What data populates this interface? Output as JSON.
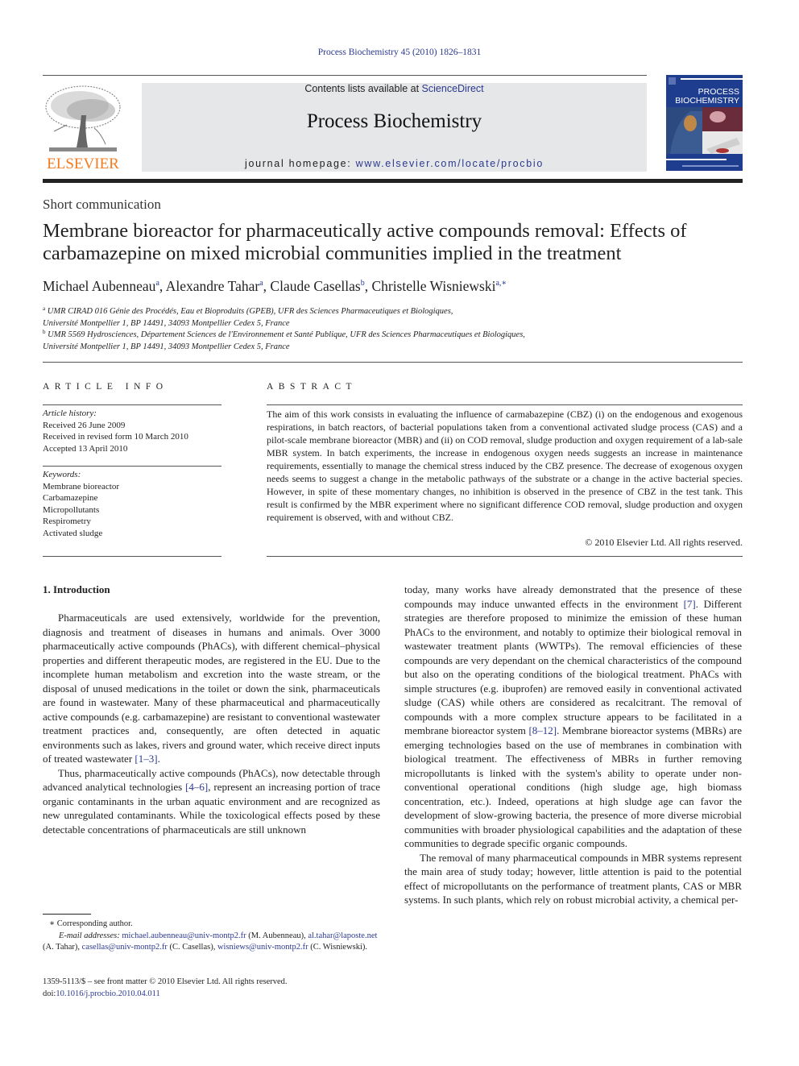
{
  "header": {
    "citation": "Process Biochemistry 45 (2010) 1826–1831",
    "contents_prefix": "Contents lists available at ",
    "contents_link": "ScienceDirect",
    "journal_title": "Process Biochemistry",
    "homepage_prefix": "journal homepage: ",
    "homepage_link": "www.elsevier.com/locate/procbio",
    "publisher_logo_text": "ELSEVIER",
    "cover_title_line1": "PROCESS",
    "cover_title_line2": "BIOCHEMISTRY"
  },
  "article": {
    "section_type": "Short communication",
    "title": "Membrane bioreactor for pharmaceutically active compounds removal: Effects of carbamazepine on mixed microbial communities implied in the treatment",
    "authors": [
      {
        "name": "Michael Aubenneau",
        "sup": "a"
      },
      {
        "name": "Alexandre Tahar",
        "sup": "a"
      },
      {
        "name": "Claude Casellas",
        "sup": "b"
      },
      {
        "name": "Christelle Wisniewski",
        "sup": "a,∗"
      }
    ],
    "affiliations": [
      {
        "sup": "a",
        "line1": "UMR CIRAD 016 Génie des Procédés, Eau et Bioproduits (GPEB), UFR des Sciences Pharmaceutiques et Biologiques,",
        "line2": "Université Montpellier 1, BP 14491, 34093 Montpellier Cedex 5, France"
      },
      {
        "sup": "b",
        "line1": "UMR 5569 Hydrosciences, Département Sciences de l'Environnement et Santé Publique, UFR des Sciences Pharmaceutiques et Biologiques,",
        "line2": "Université Montpellier 1, BP 14491, 34093 Montpellier Cedex 5, France"
      }
    ]
  },
  "article_info": {
    "heading": "ARTICLE INFO",
    "history_label": "Article history:",
    "history": [
      "Received 26 June 2009",
      "Received in revised form 10 March 2010",
      "Accepted 13 April 2010"
    ],
    "keywords_label": "Keywords:",
    "keywords": [
      "Membrane bioreactor",
      "Carbamazepine",
      "Micropollutants",
      "Respirometry",
      "Activated sludge"
    ]
  },
  "abstract": {
    "heading": "ABSTRACT",
    "text": "The aim of this work consists in evaluating the influence of carmabazepine (CBZ) (i) on the endogenous and exogenous respirations, in batch reactors, of bacterial populations taken from a conventional activated sludge process (CAS) and a pilot-scale membrane bioreactor (MBR) and (ii) on COD removal, sludge production and oxygen requirement of a lab-sale MBR system. In batch experiments, the increase in endogenous oxygen needs suggests an increase in maintenance requirements, essentially to manage the chemical stress induced by the CBZ presence. The decrease of exogenous oxygen needs seems to suggest a change in the metabolic pathways of the substrate or a change in the active bacterial species. However, in spite of these momentary changes, no inhibition is observed in the presence of CBZ in the test tank. This result is confirmed by the MBR experiment where no significant difference COD removal, sludge production and oxygen requirement is observed, with and without CBZ.",
    "copyright": "© 2010 Elsevier Ltd. All rights reserved."
  },
  "body": {
    "section_heading": "1.  Introduction",
    "left_p1": "Pharmaceuticals are used extensively, worldwide for the prevention, diagnosis and treatment of diseases in humans and animals. Over 3000 pharmaceutically active compounds (PhACs), with different chemical–physical properties and different therapeutic modes, are registered in the EU. Due to the incomplete human metabolism and excretion into the waste stream, or the disposal of unused medications in the toilet or down the sink, pharmaceuticals are found in wastewater. Many of these pharmaceutical and pharmaceutically active compounds (e.g. carbamazepine) are resistant to conventional wastewater treatment practices and, consequently, are often detected in aquatic environments such as lakes, rivers and ground water, which receive direct inputs of treated wastewater ",
    "left_p1_ref": "[1–3]",
    "left_p2_a": "Thus, pharmaceutically active compounds (PhACs), now detectable through advanced analytical technologies ",
    "left_p2_ref": "[4–6]",
    "left_p2_b": ", represent an increasing portion of trace organic contaminants in the urban aquatic environment and are recognized as new unregulated contaminants. While the toxicological effects posed by these detectable concentrations of pharmaceuticals are still unknown",
    "right_p1_a": "today, many works have already demonstrated that the presence of these compounds may induce unwanted effects in the environment ",
    "right_p1_ref1": "[7]",
    "right_p1_b": ". Different strategies are therefore proposed to minimize the emission of these human PhACs to the environment, and notably to optimize their biological removal in wastewater treatment plants (WWTPs). The removal efficiencies of these compounds are very dependant on the chemical characteristics of the compound but also on the operating conditions of the biological treatment. PhACs with simple structures (e.g. ibuprofen) are removed easily in conventional activated sludge (CAS) while others are considered as recalcitrant. The removal of compounds with a more complex structure appears to be facilitated in a membrane bioreactor system ",
    "right_p1_ref2": "[8–12]",
    "right_p1_c": ". Membrane bioreactor systems (MBRs) are emerging technologies based on the use of membranes in combination with biological treatment. The effectiveness of MBRs in further removing micropollutants is linked with the system's ability to operate under non-conventional operational conditions (high sludge age, high biomass concentration, etc.). Indeed, operations at high sludge age can favor the development of slow-growing bacteria, the presence of more diverse microbial communities with broader physiological capabilities and the adaptation of these communities to degrade specific organic compounds.",
    "right_p2": "The removal of many pharmaceutical compounds in MBR systems represent the main area of study today; however, little attention is paid to the potential effect of micropollutants on the performance of treatment plants, CAS or MBR systems. In such plants, which rely on robust microbial activity, a chemical per-"
  },
  "footnotes": {
    "corresponding": "∗  Corresponding author.",
    "email_label": "E-mail addresses:",
    "emails": [
      {
        "email": "michael.aubenneau@univ-montp2.fr",
        "name": " (M. Aubenneau),"
      },
      {
        "email": "al.tahar@laposte.net",
        "name": " (A. Tahar), "
      },
      {
        "email": "casellas@univ-montp2.fr",
        "name": " (C. Casellas),"
      },
      {
        "email": "wisniews@univ-montp2.fr",
        "name": " (C. Wisniewski)."
      }
    ],
    "front_matter": "1359-5113/$ – see front matter © 2010 Elsevier Ltd. All rights reserved.",
    "doi_prefix": "doi:",
    "doi": "10.1016/j.procbio.2010.04.011"
  },
  "colors": {
    "link": "#2b3990",
    "elsevier_orange": "#f47b20",
    "banner_bg": "#e6e7e8",
    "cover_blue": "#1f3d8f"
  }
}
